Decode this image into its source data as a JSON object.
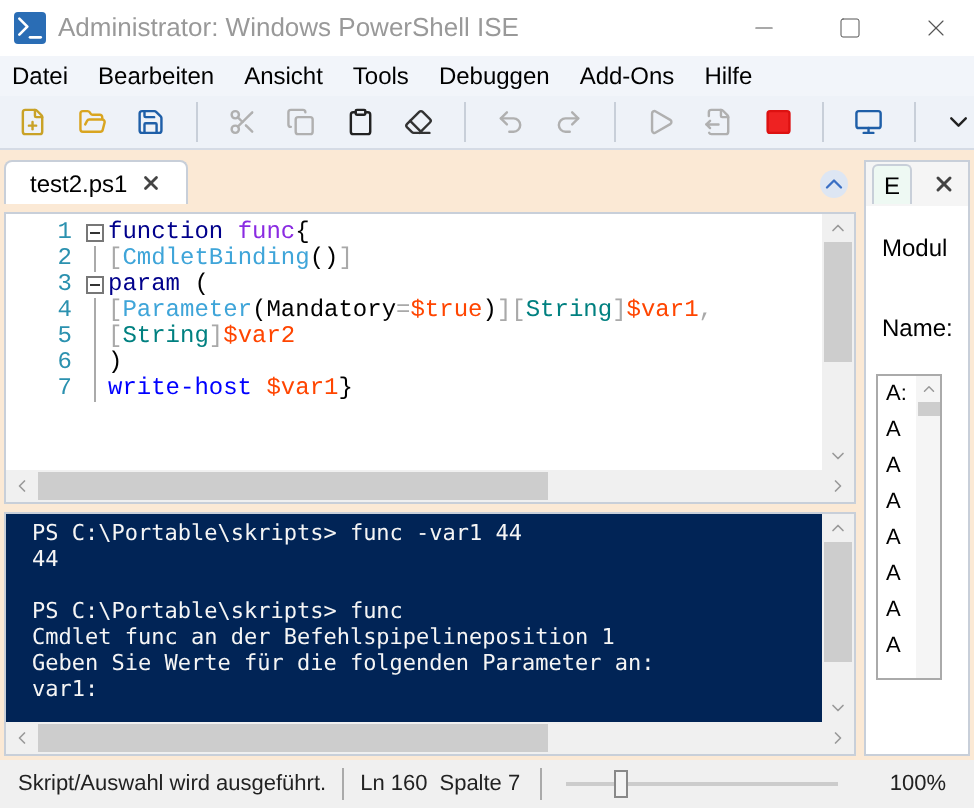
{
  "window": {
    "title": "Administrator: Windows PowerShell ISE"
  },
  "menu": [
    "Datei",
    "Bearbeiten",
    "Ansicht",
    "Tools",
    "Debuggen",
    "Add-Ons",
    "Hilfe"
  ],
  "toolbar": [
    {
      "kind": "new",
      "disabled": false
    },
    {
      "kind": "open",
      "disabled": false
    },
    {
      "kind": "save",
      "disabled": false
    },
    {
      "kind": "sep"
    },
    {
      "kind": "cut",
      "disabled": true
    },
    {
      "kind": "copy",
      "disabled": true
    },
    {
      "kind": "paste",
      "disabled": false
    },
    {
      "kind": "clear",
      "disabled": false
    },
    {
      "kind": "sep"
    },
    {
      "kind": "undo",
      "disabled": true
    },
    {
      "kind": "redo",
      "disabled": true
    },
    {
      "kind": "sep"
    },
    {
      "kind": "run",
      "disabled": true
    },
    {
      "kind": "runselection",
      "disabled": true
    },
    {
      "kind": "stop",
      "disabled": false
    },
    {
      "kind": "sep"
    },
    {
      "kind": "remote",
      "disabled": false
    },
    {
      "kind": "sep"
    },
    {
      "kind": "more",
      "disabled": false
    }
  ],
  "editor_tab": {
    "label": "test2.ps1",
    "selected": true
  },
  "code": [
    {
      "number": "1",
      "foldable": true,
      "tokens": [
        {
          "text": "function ",
          "kind": "keyword"
        },
        {
          "text": "func",
          "kind": "name"
        },
        {
          "text": "{",
          "kind": "plain"
        }
      ]
    },
    {
      "number": "2",
      "foldable": false,
      "tokens": [
        {
          "text": "[",
          "kind": "bracket"
        },
        {
          "text": "CmdletBinding",
          "kind": "attribute"
        },
        {
          "text": "()",
          "kind": "plain"
        },
        {
          "text": "]",
          "kind": "bracket"
        }
      ]
    },
    {
      "number": "3",
      "foldable": true,
      "tokens": [
        {
          "text": "param",
          "kind": "keyword"
        },
        {
          "text": " (",
          "kind": "plain"
        }
      ]
    },
    {
      "number": "4",
      "foldable": false,
      "tokens": [
        {
          "text": "[",
          "kind": "bracket"
        },
        {
          "text": "Parameter",
          "kind": "attribute"
        },
        {
          "text": "(Mandatory",
          "kind": "plain"
        },
        {
          "text": "=",
          "kind": "bracket"
        },
        {
          "text": "$true",
          "kind": "variable"
        },
        {
          "text": ")",
          "kind": "plain"
        },
        {
          "text": "][",
          "kind": "bracket"
        },
        {
          "text": "String",
          "kind": "type"
        },
        {
          "text": "]",
          "kind": "bracket"
        },
        {
          "text": "$var1",
          "kind": "variable"
        },
        {
          "text": ",",
          "kind": "bracket"
        }
      ]
    },
    {
      "number": "5",
      "foldable": false,
      "tokens": [
        {
          "text": "[",
          "kind": "bracket"
        },
        {
          "text": "String",
          "kind": "type"
        },
        {
          "text": "]",
          "kind": "bracket"
        },
        {
          "text": "$var2",
          "kind": "variable"
        }
      ]
    },
    {
      "number": "6",
      "foldable": false,
      "tokens": [
        {
          "text": ")",
          "kind": "plain"
        }
      ]
    },
    {
      "number": "7",
      "foldable": false,
      "tokens": [
        {
          "text": "write-host ",
          "kind": "command"
        },
        {
          "text": "$var1",
          "kind": "variable"
        },
        {
          "text": "}",
          "kind": "plain"
        }
      ]
    }
  ],
  "console": [
    {
      "lines": [
        "PS C:\\Portable\\skripts> func -var1 44",
        "44"
      ]
    },
    {
      "lines": [
        "PS C:\\Portable\\skripts> func",
        "Cmdlet func an der Befehlspipelineposition 1",
        "Geben Sie Werte für die folgenden Parameter an:",
        "var1:"
      ]
    }
  ],
  "side_panel": {
    "tab": "E",
    "labels": [
      "Modul",
      "Name:"
    ],
    "list": [
      "A:",
      "A",
      "A",
      "A",
      "A",
      "A",
      "A",
      "A"
    ]
  },
  "status_bar": {
    "message": "Skript/Auswahl wird ausgeführt.",
    "line": "Ln 160",
    "column": "Spalte 7",
    "zoom": {
      "level": 0.2
    },
    "zoom_text": "100%"
  }
}
